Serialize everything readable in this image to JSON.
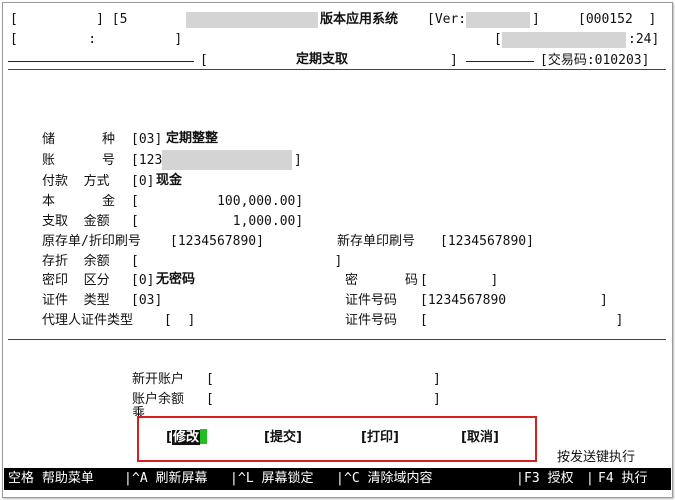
{
  "header": {
    "row1_left": "[          ] [5         ]",
    "system_title": "版本应用系统",
    "version_label": "[Ver:",
    "version_close": "]",
    "page_no": "[000152  ]",
    "row2_left": "[         :          ]",
    "row2_right_open": "[",
    "time_suffix": ":24]",
    "screen_title_open": "[",
    "screen_title": "定期支取",
    "screen_title_close": "]",
    "transaction_code": "[交易码:010203]"
  },
  "form": {
    "deposit_type": {
      "label": "储      种",
      "code": "[03]",
      "value": "定期整整"
    },
    "account_no": {
      "label": "账      号",
      "prefix": "[123",
      "close": "]"
    },
    "payment_method": {
      "label": "付款  方式",
      "code": "[0]",
      "value": "现金"
    },
    "principal": {
      "label": "本      金",
      "value": "[          100,000.00]"
    },
    "withdraw_amount": {
      "label": "支取  金额",
      "value": "[            1,000.00]"
    },
    "orig_passbook_no": {
      "label": "原存单/折印刷号",
      "value": "[1234567890]"
    },
    "new_passbook_no": {
      "label": "新存单印刷号",
      "value": "[1234567890]"
    },
    "passbook_balance": {
      "label": "存折  余额",
      "value": "[                         ]"
    },
    "seal_type": {
      "label": "密印  区分",
      "code": "[0]",
      "value": "无密码"
    },
    "password": {
      "label": "密      码",
      "value": "[        ]"
    },
    "id_type": {
      "label": "证件  类型",
      "value": "[03]"
    },
    "id_no": {
      "label": "证件号码",
      "value": "[1234567890            ]"
    },
    "agent_id_type": {
      "label": "代理人证件类型",
      "value": "[  ]"
    },
    "agent_id_no": {
      "label": "证件号码",
      "value": "[                        ]"
    }
  },
  "lower": {
    "new_account": {
      "label": "新开账户",
      "value": "[                            ]"
    },
    "account_balance": {
      "label": "账户余额",
      "value": "[                            ]"
    },
    "partial_char": "乘"
  },
  "buttons": {
    "modify": "修改",
    "submit": "[提交]",
    "print": "[打印]",
    "cancel": "[取消]"
  },
  "hint": "按发送键执行",
  "statusbar": {
    "item1": "空格 帮助菜单",
    "item2": "^A 刷新屏幕",
    "item3": "^L 屏幕锁定",
    "item4": "^C 清除域内容",
    "item5": "F3 授权",
    "item6": "F4 执行",
    "sep": "|"
  },
  "colors": {
    "highlight_box": "#d62020",
    "cursor": "#20c020",
    "statusbar_bg": "#000000"
  }
}
